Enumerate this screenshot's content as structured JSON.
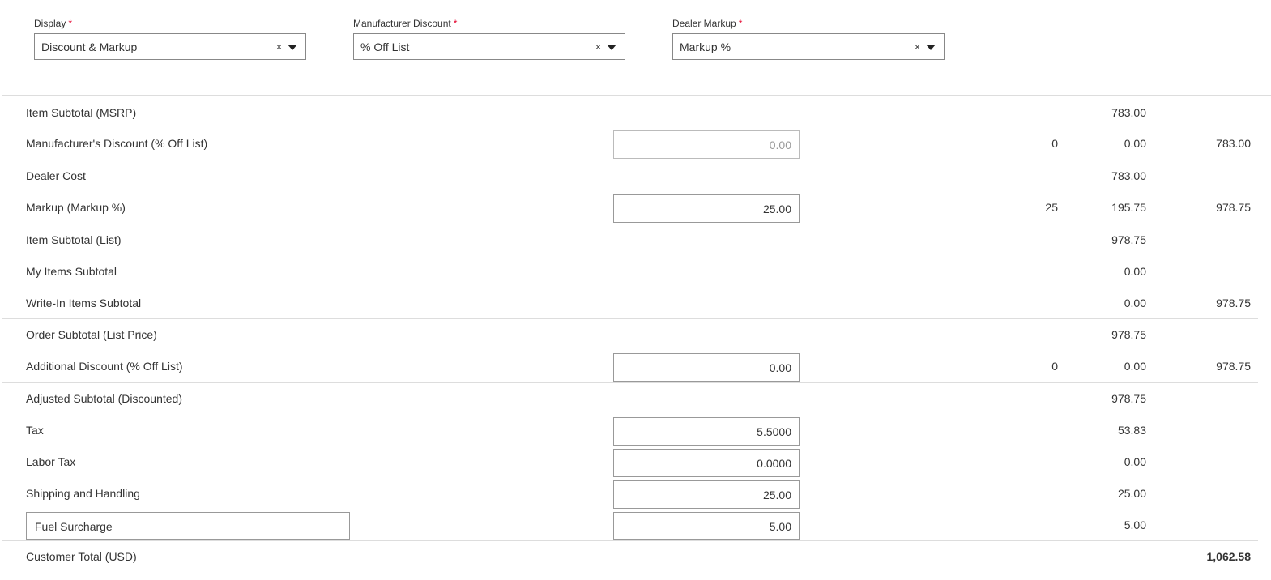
{
  "dropdowns": [
    {
      "label": "Display",
      "value": "Discount & Markup"
    },
    {
      "label": "Manufacturer Discount",
      "value": "% Off List"
    },
    {
      "label": "Dealer Markup",
      "value": "Markup %"
    }
  ],
  "required_mark": "*",
  "clear_glyph": "×",
  "rows": {
    "item_subtotal_msrp": {
      "label": "Item Subtotal (MSRP)",
      "amount": "783.00"
    },
    "mfr_discount": {
      "label": "Manufacturer's Discount (% Off List)",
      "input": "0.00",
      "percent": "0",
      "amount": "0.00",
      "running": "783.00"
    },
    "dealer_cost": {
      "label": "Dealer Cost",
      "amount": "783.00"
    },
    "markup": {
      "label": "Markup (Markup %)",
      "input": "25.00",
      "percent": "25",
      "amount": "195.75",
      "running": "978.75"
    },
    "item_subtotal_list": {
      "label": "Item Subtotal (List)",
      "amount": "978.75"
    },
    "my_items_subtotal": {
      "label": "My Items Subtotal",
      "amount": "0.00"
    },
    "write_in_subtotal": {
      "label": "Write-In Items Subtotal",
      "amount": "0.00",
      "running": "978.75"
    },
    "order_subtotal": {
      "label": "Order Subtotal (List Price)",
      "amount": "978.75"
    },
    "additional_discount": {
      "label": "Additional Discount (% Off List)",
      "input": "0.00",
      "percent": "0",
      "amount": "0.00",
      "running": "978.75"
    },
    "adjusted_subtotal": {
      "label": "Adjusted Subtotal (Discounted)",
      "amount": "978.75"
    },
    "tax": {
      "label": "Tax",
      "input": "5.5000",
      "amount": "53.83"
    },
    "labor_tax": {
      "label": "Labor Tax",
      "input": "0.0000",
      "amount": "0.00"
    },
    "shipping": {
      "label": "Shipping and Handling",
      "input": "25.00",
      "amount": "25.00"
    },
    "fuel_surcharge": {
      "name": "Fuel Surcharge",
      "input": "5.00",
      "amount": "5.00"
    },
    "customer_total": {
      "label": "Customer Total (USD)",
      "total": "1,062.58"
    }
  }
}
